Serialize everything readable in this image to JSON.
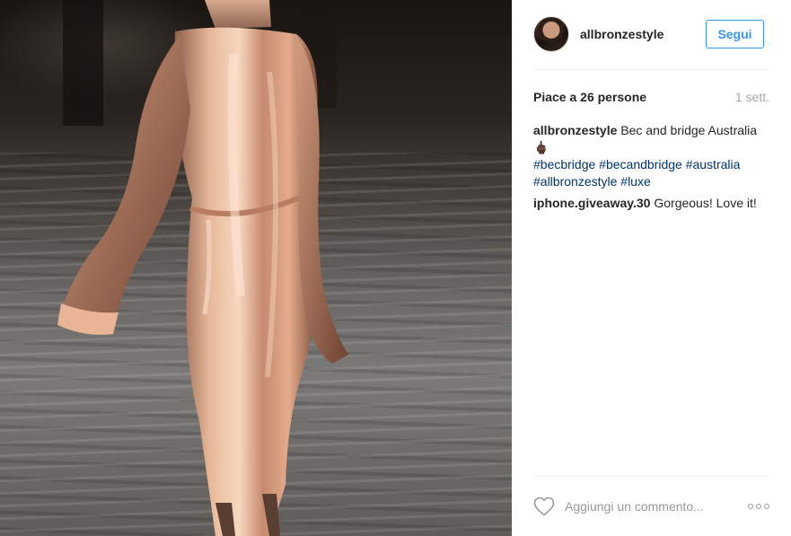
{
  "post": {
    "username": "allbronzestyle",
    "follow_label": "Segui",
    "likes_text": "Piace a 26 persone",
    "age_text": "1 sett."
  },
  "caption": {
    "username": "allbronzestyle",
    "text": "Bec and bridge Australia 🖕🏿",
    "hashtags": [
      "#becbridge",
      "#becandbridge",
      "#australia",
      "#allbronzestyle",
      "#luxe"
    ]
  },
  "comments": [
    {
      "username": "iphone.giveaway.30",
      "text": "Gorgeous! Love it!"
    }
  ],
  "composer": {
    "placeholder": "Aggiungi un commento..."
  },
  "icons": {
    "like": "heart-outline-icon",
    "more": "more-options-icon"
  },
  "colors": {
    "accent": "#3897f0",
    "hashtag": "#003569",
    "muted": "#a5a7aa"
  }
}
